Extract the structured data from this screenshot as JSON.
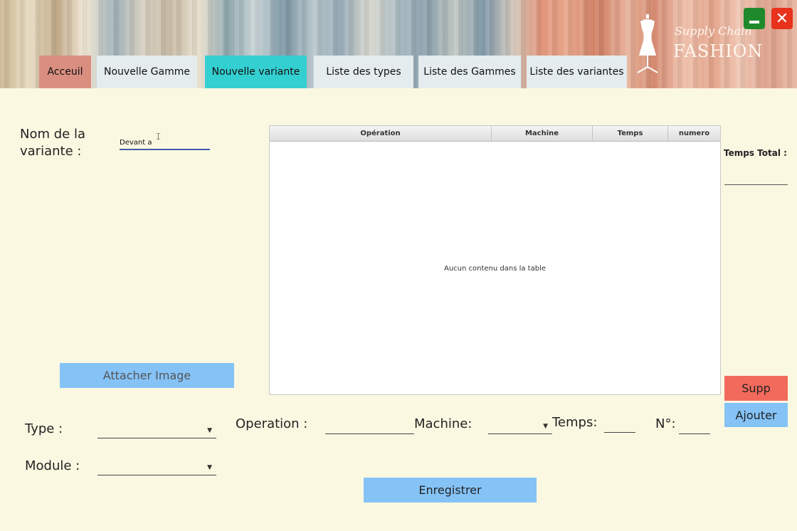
{
  "window": {
    "minimize_icon": "minimize-icon",
    "close_icon": "close-icon",
    "close_glyph": "✕"
  },
  "logo": {
    "script_text": "Supply Chain",
    "word_text": "FASHION",
    "icon": "dress-form-icon"
  },
  "tabs": [
    {
      "label": "Acceuil"
    },
    {
      "label": "Nouvelle Gamme"
    },
    {
      "label": "Nouvelle variante"
    },
    {
      "label": "Liste des types"
    },
    {
      "label": "Liste des Gammes"
    },
    {
      "label": "Liste des variantes"
    }
  ],
  "form": {
    "name_label_line1": "Nom de la",
    "name_label_line2": "variante :",
    "name_value": "Devant a",
    "attach_button": "Attacher Image",
    "type_label": "Type :",
    "module_label": "Module :",
    "operation_label": "Operation :",
    "machine_label": "Machine:",
    "temps_label": "Temps:",
    "numero_label": "N°:",
    "temps_total_label": "Temps Total :",
    "supp_button": "Supp",
    "ajouter_button": "Ajouter",
    "save_button": "Enregistrer"
  },
  "table": {
    "columns": [
      "Opération",
      "Machine",
      "Temps",
      "numero"
    ],
    "rows": [],
    "empty_message": "Aucun contenu dans la table"
  },
  "colors": {
    "background": "#fbf8e2",
    "active_tab": "#34cfd1",
    "home_tab": "#d98e80",
    "primary_button": "#85c3f7",
    "danger_button": "#f26a5c"
  }
}
